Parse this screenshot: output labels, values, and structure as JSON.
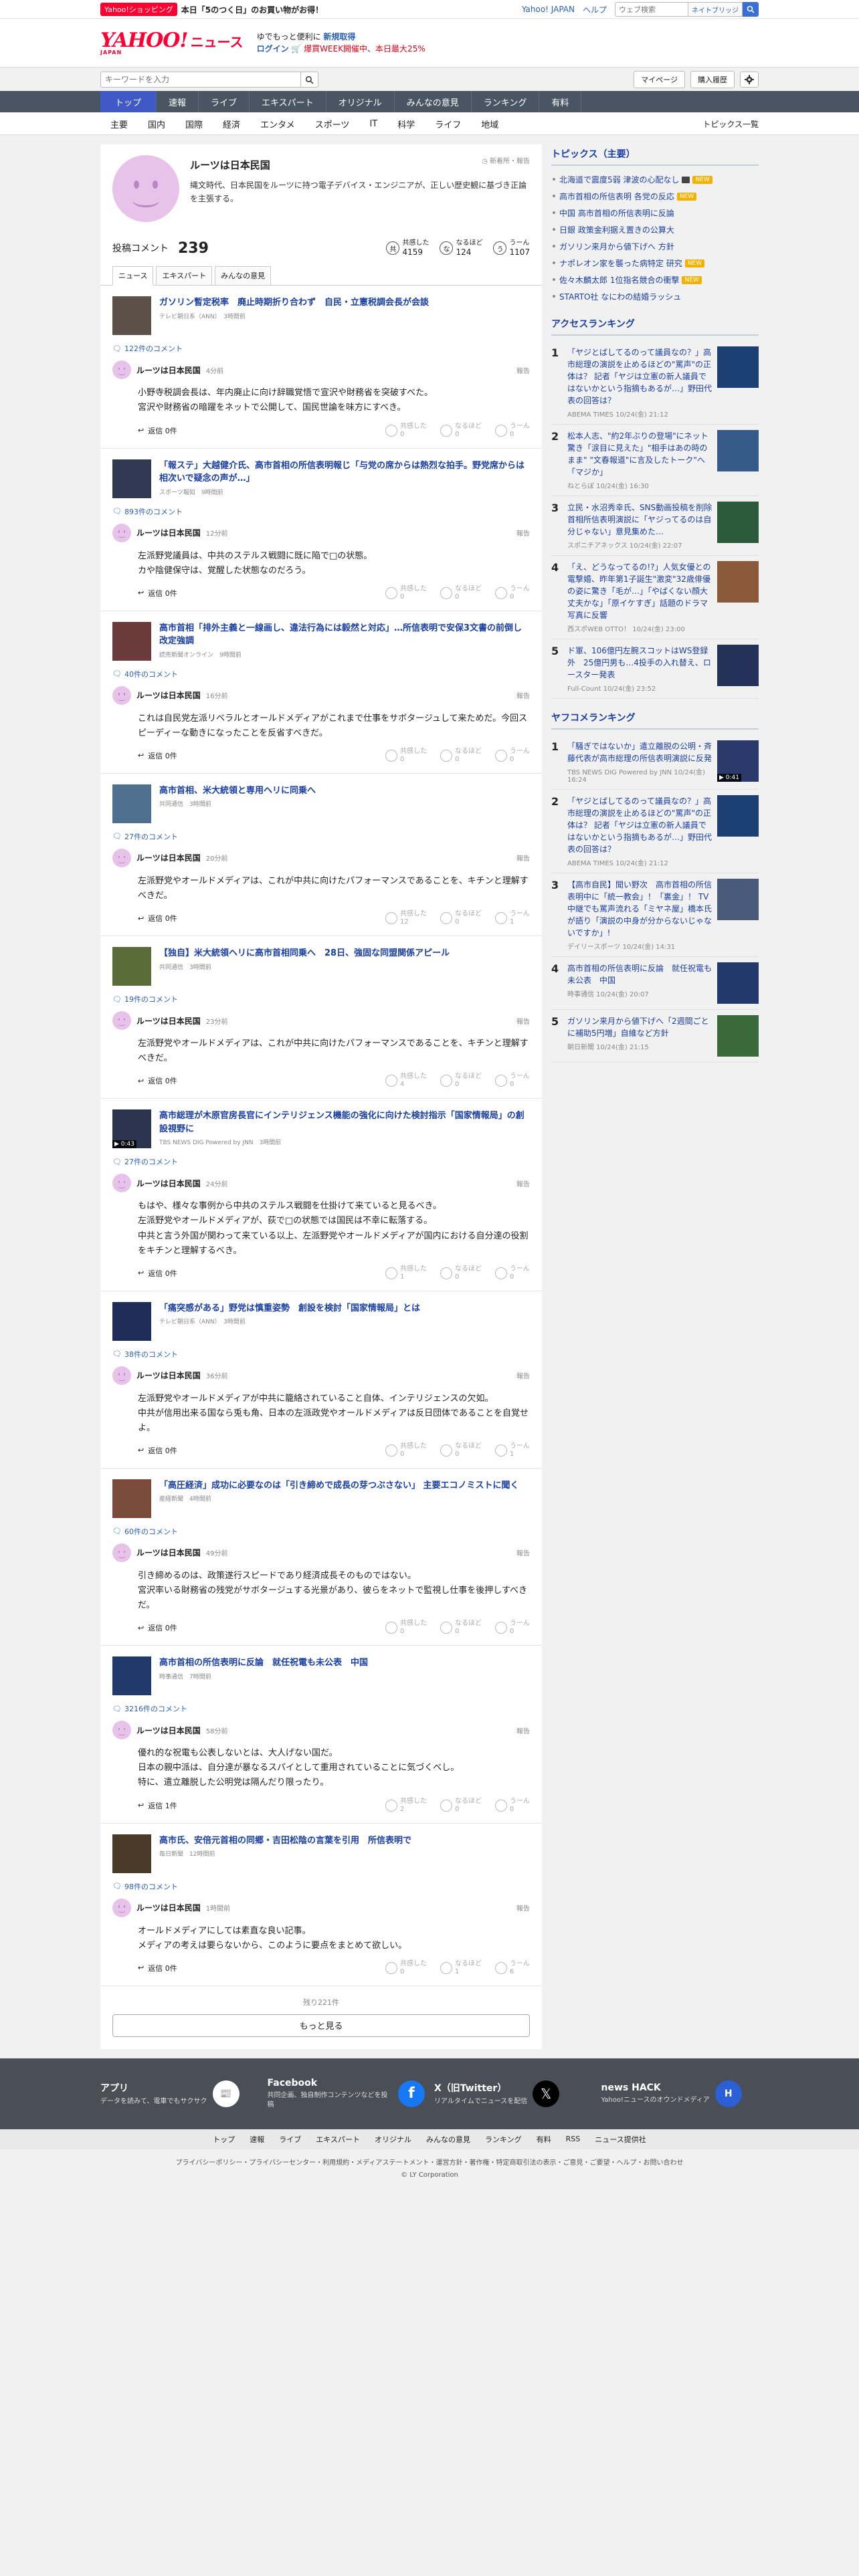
{
  "topbar": {
    "tag": "Yahoo!ショッピング",
    "promo": "本日「5のつく日」のお買い物がお得！",
    "links": [
      "Yahoo! JAPAN",
      "ヘルプ"
    ],
    "search_placeholder": "ウェブ検索",
    "search_button": "ネイトブリッジ"
  },
  "header": {
    "logo": "YAHOO!",
    "logo_sub": "JAPAN",
    "logo_news": "ニュース",
    "promo_line1_a": "ゆでもっと便利に",
    "promo_line1_b": "新規取得",
    "promo_line2_a": "ログイン",
    "promo_line2_b": "🛒 爆買WEEK開催中、本日最大25%"
  },
  "searchrow": {
    "placeholder": "キーワードを入力",
    "mypage": "マイページ",
    "history": "購入履歴"
  },
  "mainnav": [
    "トップ",
    "速報",
    "ライブ",
    "エキスパート",
    "オリジナル",
    "みんなの意見",
    "ランキング",
    "有料"
  ],
  "subnav": [
    "主要",
    "国内",
    "国際",
    "経済",
    "エンタメ",
    "スポーツ",
    "IT",
    "科学",
    "ライフ",
    "地域"
  ],
  "subnav_right": "トピックス一覧",
  "profile": {
    "name": "ルーツは日本民国",
    "desc": "縄文時代、日本民国をルーツに持つ電子デバイス・エンジニアが、正しい歴史観に基づき正論を主張する。",
    "note": "新着所・報告",
    "comment_label": "投稿コメント",
    "comment_count": "239",
    "reactions": [
      {
        "icon": "共",
        "label": "共感した",
        "value": "4159"
      },
      {
        "icon": "な",
        "label": "なるほど",
        "value": "124"
      },
      {
        "icon": "う",
        "label": "うーん",
        "value": "1107"
      }
    ]
  },
  "tabs": [
    "ニュース",
    "エキスパート",
    "みんなの意見"
  ],
  "common": {
    "reply": "返信 0件",
    "report": "報告",
    "rx_labels": [
      "共感した",
      "なるほど",
      "うーん"
    ]
  },
  "entries": [
    {
      "title": "ガソリン暫定税率　廃止時期折り合わず　自民・立憲税調会長が会談",
      "source": "テレビ朝日系（ANN）　3時間前",
      "thumb_color": "#5b5149",
      "overlay": "",
      "count": "122件のコメント",
      "time": "4分前",
      "text": "小野寺税調会長は、年内廃止に向け辞職覚悟で宣沢や財務省を突破すべた。\n宮沢や財務省の暗躍をネットで公開して、国民世論を味方にすべき。",
      "rx": [
        "0",
        "0",
        "0"
      ],
      "reply": "返信 0件"
    },
    {
      "title": "「報ステ」大越健介氏、高市首相の所信表明報じ「与党の席からは熱烈な拍手。野党席からは相次いで疑念の声が…」",
      "source": "スポーツ報知　9時間前",
      "thumb_color": "#2f3a52",
      "overlay": "",
      "count": "893件のコメント",
      "time": "12分前",
      "text": "左派野党議員は、中共のステルス戦闘に既に陥で□の状態。\nカや陰健保守は、覚醒した状態なのだろう。",
      "rx": [
        "0",
        "0",
        "0"
      ],
      "reply": "返信 0件"
    },
    {
      "title": "高市首相「排外主義と一線画し、違法行為には毅然と対応」…所信表明で安保3文書の前倒し改定強調",
      "source": "読売新聞オンライン　9時間前",
      "thumb_color": "#6b3a3a",
      "overlay": "",
      "count": "40件のコメント",
      "time": "16分前",
      "text": "これは自民党左派リベラルとオールドメディアがこれまで仕事をサボタージュして来ためだ。今回スピーディーな動きになったことを反省すべきだ。",
      "rx": [
        "0",
        "0",
        "0"
      ],
      "reply": "返信 0件"
    },
    {
      "title": "高市首相、米大統領と専用ヘリに同乗へ",
      "source": "共同通信　3時間前",
      "thumb_color": "#4f6f8f",
      "overlay": "",
      "count": "27件のコメント",
      "time": "20分前",
      "text": "左派野党やオールドメディアは、これが中共に向けたパフォーマンスであることを、キチンと理解すべきだ。",
      "rx": [
        "12",
        "0",
        "1"
      ],
      "reply": "返信 0件"
    },
    {
      "title": "【独自】米大統領ヘリに高市首相同乗へ　28日、強固な同盟関係アピール",
      "source": "共同通信　3時間前",
      "thumb_color": "#5a6b3a",
      "overlay": "",
      "count": "19件のコメント",
      "time": "23分前",
      "text": "左派野党やオールドメディアは、これが中共に向けたパフォーマンスであることを、キチンと理解すべきだ。",
      "rx": [
        "4",
        "0",
        "0"
      ],
      "reply": "返信 0件"
    },
    {
      "title": "高市総理が木原官房長官にインテリジェンス機能の強化に向けた検討指示「国家情報局」の創設視野に",
      "source": "TBS NEWS DIG Powered by JNN　3時間前",
      "thumb_color": "#2b3550",
      "overlay": "▶ 0:43",
      "count": "27件のコメント",
      "time": "24分前",
      "text": "もはや、様々な事例から中共のステルス戦闘を仕掛けて来ていると見るべき。\n左派野党やオールドメディアが、荻で□の状態では国民は不幸に転落する。\n中共と言う外国が関わって来ている以上、左派野党やオールドメディアが国内における自分達の役割をキチンと理解するべき。",
      "rx": [
        "1",
        "0",
        "0"
      ],
      "reply": "返信 0件"
    },
    {
      "title": "「痛突感がある」野党は慎重姿勢　創設を検討「国家情報局」とは",
      "source": "テレビ朝日系（ANN）　3時間前",
      "thumb_color": "#1f2c5a",
      "overlay": "",
      "count": "38件のコメント",
      "time": "36分前",
      "text": "左派野党やオールドメディアが中共に籠絡されていること自体、インテリジェンスの欠如。\n中共が信用出来る国なら兎も角、日本の左派政党やオールドメディアは反日団体であることを自覚せよ。",
      "rx": [
        "0",
        "0",
        "1"
      ],
      "reply": "返信 0件"
    },
    {
      "title": "「高圧経済」成功に必要なのは「引き締めで成長の芽つぶさない」 主要エコノミストに聞く",
      "source": "産経新聞　4時間前",
      "thumb_color": "#7a4a3a",
      "overlay": "",
      "count": "60件のコメント",
      "time": "49分前",
      "text": "引き締めるのは、政策遂行スピードであり経済成長そのものではない。\n宮沢率いる財務省の残党がサボタージュする光景があり、彼らをネットで監視し仕事を後押しすべきだ。",
      "rx": [
        "0",
        "0",
        "0"
      ],
      "reply": "返信 0件"
    },
    {
      "title": "高市首相の所信表明に反論　就任祝電も未公表　中国",
      "source": "時事通信　7時間前",
      "thumb_color": "#223a6b",
      "overlay": "",
      "count": "3216件のコメント",
      "time": "58分前",
      "text": "優れ的な祝電も公表しないとは、大人げない国だ。\n日本の親中派は、自分達が暴なるスパイとして重用されていることに気づくべし。\n特に、遣立離脱した公明党は隔んだり限ったり。",
      "rx": [
        "2",
        "0",
        "0"
      ],
      "reply": "返信 1件"
    },
    {
      "title": "高市氏、安倍元首相の同郷・吉田松陰の言葉を引用　所信表明で",
      "source": "毎日新聞　12時間前",
      "thumb_color": "#4a3a2a",
      "overlay": "",
      "count": "98件のコメント",
      "time": "1時間前",
      "text": "オールドメディアにしては素直な良い記事。\nメディアの考えは要らないから、このように要点をまとめて欲しい。",
      "rx": [
        "0",
        "1",
        "6"
      ],
      "reply": "返信 0件"
    }
  ],
  "more": {
    "remain": "残り221件",
    "button": "もっと見る"
  },
  "sidebar": {
    "topics_title": "トピックス（主要）",
    "topics": [
      {
        "text": "北海道で震度5弱 津波の心配なし",
        "img": true,
        "new": true
      },
      {
        "text": "高市首相の所信表明 各党の反応",
        "img": false,
        "new": true
      },
      {
        "text": "中国 高市首相の所信表明に反論",
        "img": false,
        "new": false
      },
      {
        "text": "日銀 政策金利据え置きの公算大",
        "img": false,
        "new": false
      },
      {
        "text": "ガソリン来月から値下げへ 方針",
        "img": false,
        "new": false
      },
      {
        "text": "ナポレオン家を襲った病特定 研究",
        "img": false,
        "new": true
      },
      {
        "text": "佐々木麟太郎 1位指名競合の衝撃",
        "img": false,
        "new": true
      },
      {
        "text": "STARTO社 なにわの結婚ラッシュ",
        "img": false,
        "new": false
      }
    ],
    "access_title": "アクセスランキング",
    "access": [
      {
        "n": "1",
        "title": "「ヤジとばしてるのって議員なの？」高市総理の演説を止めるほどの\"罵声\"の正体は？ 記者「ヤジは立憲の新人議員ではないかという指摘もあるが…」野田代表の回答は？",
        "src": "ABEMA TIMES 10/24(金) 21:12",
        "color": "#1c3f74",
        "overlay": ""
      },
      {
        "n": "2",
        "title": "松本人志、\"約2年ぶりの登場\"にネット驚き「涙目に見えた」\"相手はあの時のまま\" \"文春報道\"に言及したトーク\"へ「マジか」",
        "src": "ねとらぼ 10/24(金) 16:30",
        "color": "#355a8a",
        "overlay": ""
      },
      {
        "n": "3",
        "title": "立民・水沼秀幸氏、SNS動画投稿を削除　首相所信表明演説に「ヤジってるのは自分じゃない」意見集めた…",
        "src": "スポニチアネックス 10/24(金) 22:07",
        "color": "#2a5a3a",
        "overlay": ""
      },
      {
        "n": "4",
        "title": "「え、どうなってるの!?」人気女優との電撃婚、昨年第1子誕生\"激変\"32歳俳優の姿に驚き「毛が…」「やばくない顔大丈夫かな」「原イケすぎ」話題のドラマ写真に反響",
        "src": "西スポWEB OTTO！ 10/24(金) 23:00",
        "color": "#8a5a3a",
        "overlay": ""
      },
      {
        "n": "5",
        "title": "ド軍、106億円左腕スコットはWS登録外　25億円男も…4投手の入れ替え、ロースター発表",
        "src": "Full-Count 10/24(金) 23:52",
        "color": "#24325a",
        "overlay": ""
      }
    ],
    "yahoo_title": "ヤフコメランキング",
    "yahoo": [
      {
        "n": "1",
        "title": "「騒ぎではないか」遣立離脱の公明・斉藤代表が高市総理の所信表明演説に反発",
        "src": "TBS NEWS DIG Powered by JNN 10/24(金) 16:24",
        "color": "#2a3a6a",
        "overlay": "▶ 0:41"
      },
      {
        "n": "2",
        "title": "「ヤジとばしてるのって議員なの？」高市総理の演説を止めるほどの\"罵声\"の正体は？ 記者「ヤジは立憲の新人議員ではないかという指摘もあるが…」野田代表の回答は？",
        "src": "ABEMA TIMES 10/24(金) 21:12",
        "color": "#1c3f74",
        "overlay": ""
      },
      {
        "n": "3",
        "title": "【高市自民】聞い野次　高市首相の所信表明中に「統一教会」！「裏金」！ TV中継でも罵声流れる「ミヤネ屋」橋本氏が語り「演説の中身が分からないじゃないですか」!",
        "src": "デイリースポーツ 10/24(金) 14:31",
        "color": "#4a5a7a",
        "overlay": ""
      },
      {
        "n": "4",
        "title": "高市首相の所信表明に反論　就任祝電も未公表　中国",
        "src": "時事通信 10/24(金) 20:07",
        "color": "#223a6b",
        "overlay": ""
      },
      {
        "n": "5",
        "title": "ガソリン来月から値下げへ「2週間ごとに補助5円増」自維など方針",
        "src": "朝日新聞 10/24(金) 21:15",
        "color": "#3a6a3a",
        "overlay": ""
      }
    ]
  },
  "footer": {
    "cards": [
      {
        "title": "アプリ",
        "desc": "データを読みて、電車でもサクサク",
        "icon": "📰"
      },
      {
        "title": "Facebook",
        "desc": "共同企画、独自制作コンテンツなどを投稿",
        "icon": "f"
      },
      {
        "title": "X（旧Twitter）",
        "desc": "リアルタイムでニュースを配信",
        "icon": "𝕏"
      },
      {
        "title": "news HACK",
        "desc": "Yahoo!ニュースのオウンドメディア",
        "icon": "H"
      }
    ],
    "links": [
      "トップ",
      "速報",
      "ライブ",
      "エキスパート",
      "オリジナル",
      "みんなの意見",
      "ランキング",
      "有料",
      "RSS",
      "ニュース提供社"
    ],
    "legal": "プライバシーポリシー・プライバシーセンター・利用規約・メディアステートメント・運営方針・著作権・特定商取引法の表示・ご意見・ご要望・ヘルプ・お問い合わせ",
    "copyright": "© LY Corporation"
  },
  "colors": {
    "accent": "#ff0033",
    "link": "#1a3fa3",
    "nav": "#4a5563",
    "nav_active": "#3f5ac6",
    "avatar": "#e7c3ea"
  }
}
